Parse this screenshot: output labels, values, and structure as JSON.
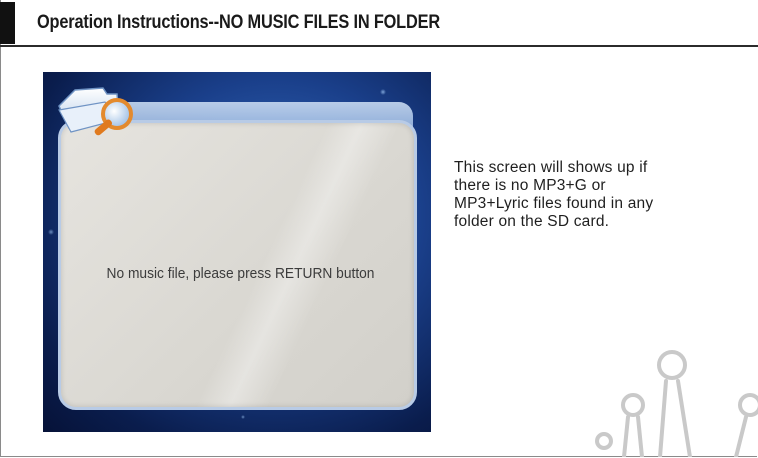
{
  "header": {
    "title": "Operation Instructions--NO MUSIC FILES IN FOLDER"
  },
  "screen": {
    "message": "No music file, please press RETURN button"
  },
  "description": {
    "lines": [
      "This screen will shows up if",
      "there is no MP3+G or",
      "MP3+Lyric files found in any",
      "folder on the SD card."
    ]
  },
  "icons": {
    "screen_icon": "folder-magnifier-icon",
    "decor": "people-figures-decoration"
  },
  "colors": {
    "screen_blue": "#1a3f8a",
    "panel_gray": "#dddbd5",
    "header_bar": "#111111"
  }
}
